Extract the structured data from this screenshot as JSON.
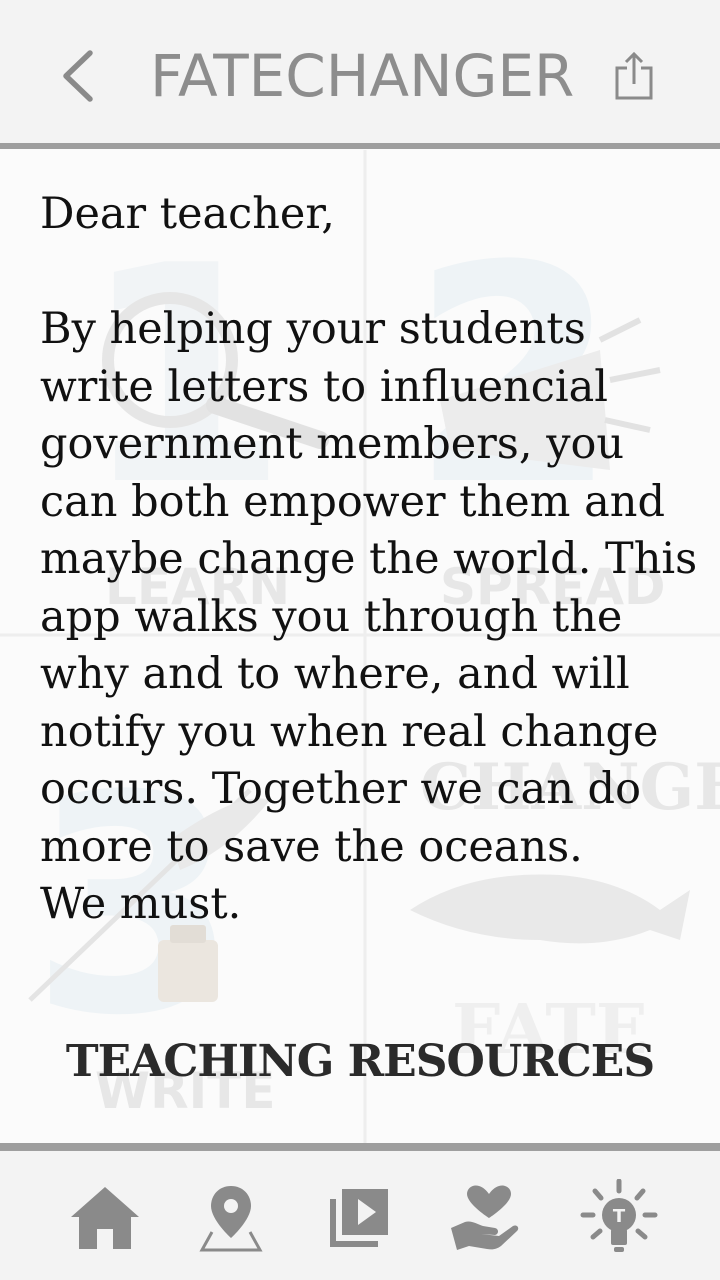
{
  "header": {
    "title": "FATECHANGER",
    "back_icon": "chevron-left-icon",
    "share_icon": "share-icon"
  },
  "background": {
    "labels": [
      "LEARN",
      "SPREAD",
      "CHANGE",
      "FATE",
      "WRITE"
    ]
  },
  "letter": {
    "greeting": "Dear teacher,",
    "body": "By helping your students write letters to influencial government members, you can both empower them and maybe change the world. This app walks you through the why and to where, and will notify you when real change occurs. Together we can do more to save the oceans.",
    "closing": "We must."
  },
  "resources": {
    "label": "TEACHING RESOURCES"
  },
  "bottom_nav": {
    "items": [
      {
        "icon": "home-icon"
      },
      {
        "icon": "map-pin-icon"
      },
      {
        "icon": "video-library-icon"
      },
      {
        "icon": "heart-hand-icon"
      },
      {
        "icon": "lightbulb-icon"
      }
    ]
  },
  "colors": {
    "icon_gray": "#8a8a8a",
    "rule_gray": "#9e9e9e",
    "text": "#111111"
  }
}
